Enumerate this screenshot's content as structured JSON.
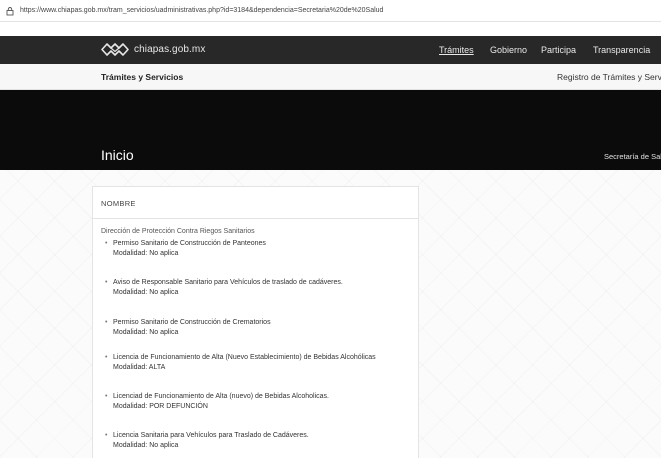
{
  "browser": {
    "url": "https://www.chiapas.gob.mx/tram_servicios/uadministrativas.php?id=3184&dependencia=Secretaria%20de%20Salud"
  },
  "nav": {
    "logo_text": "chiapas.gob.mx",
    "links": [
      "Trámites",
      "Gobierno",
      "Participa",
      "Transparencia"
    ]
  },
  "subheader": {
    "left": "Trámites y Servicios",
    "right": "Registro de Trámites y Servici"
  },
  "hero": {
    "title": "Inicio",
    "breadcrumb": "Secretaría de Salu"
  },
  "card": {
    "header": "NOMBRE",
    "department": "Dirección de Protección Contra Riegos Sanitarios",
    "items": [
      {
        "name": "Permiso Sanitario de Construcción de Panteones",
        "modality": "Modalidad: No aplica"
      },
      {
        "name": "Aviso de Responsable Sanitario para Vehículos de traslado de cadáveres.",
        "modality": "Modalidad: No aplica"
      },
      {
        "name": "Permiso Sanitario de Construcción de Crematorios",
        "modality": "Modalidad: No aplica"
      },
      {
        "name": "Licencia de Funcionamiento de Alta (Nuevo Establecimiento) de Bebidas Alcohólicas",
        "modality": "Modalidad: ALTA"
      },
      {
        "name": "Licenciad de Funcionamiento de Alta (nuevo) de Bebidas Alcoholicas.",
        "modality": "Modalidad: POR DEFUNCIÓN"
      },
      {
        "name": "Licencia Sanitaria para Vehículos para Traslado de Cadáveres.",
        "modality": "Modalidad: No aplica"
      }
    ]
  },
  "colors": {
    "nav_bg": "#282828",
    "hero_bg": "#0b0b0b",
    "subheader_bg": "#f7f7f7"
  }
}
